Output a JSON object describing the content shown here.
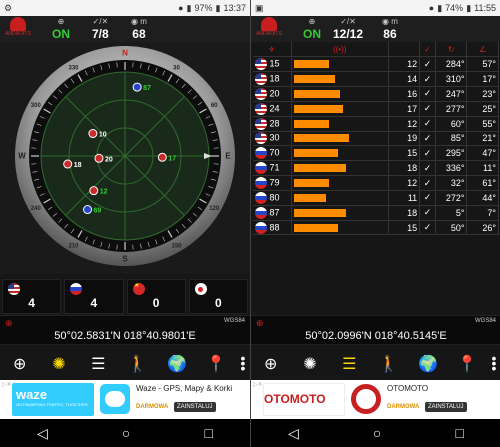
{
  "status_left": {
    "battery": "97%",
    "time": "13:37"
  },
  "status_right": {
    "battery": "74%",
    "time": "11:55"
  },
  "logo_text": "ANDROITS",
  "left_header": {
    "fix": "ON",
    "sats": "7/8",
    "alt": "68",
    "alt_unit": "m"
  },
  "right_header": {
    "fix": "ON",
    "sats": "12/12",
    "alt": "86",
    "alt_unit": "m"
  },
  "compass": {
    "marks": [
      "N",
      "30",
      "60",
      "E",
      "120",
      "150",
      "S",
      "210",
      "240",
      "W",
      "300",
      "330"
    ],
    "sats": [
      {
        "id": "87",
        "flag": "ru",
        "color": "#33cc33"
      },
      {
        "id": "10",
        "flag": "us",
        "color": "#ffffff"
      },
      {
        "id": "20",
        "flag": "us",
        "color": "#ffffff"
      },
      {
        "id": "18",
        "flag": "us",
        "color": "#ffffff"
      },
      {
        "id": "17",
        "flag": "us",
        "color": "#33cc33"
      },
      {
        "id": "12",
        "flag": "us",
        "color": "#33cc33"
      },
      {
        "id": "69",
        "flag": "ru",
        "color": "#33cc33"
      }
    ]
  },
  "counts": [
    {
      "flag": "us",
      "value": "4"
    },
    {
      "flag": "ru",
      "value": "4"
    },
    {
      "flag": "cn",
      "value": "0"
    },
    {
      "flag": "jp",
      "value": "0"
    }
  ],
  "coords_left": {
    "datum": "WGS84",
    "value": "50°02.5831'N  018°40.9801'E"
  },
  "coords_right": {
    "datum": "WGS84",
    "value": "50°02.0996'N  018°40.5145'E"
  },
  "nav_icons": [
    "target-icon",
    "radar-icon",
    "bars-icon",
    "walk-icon",
    "globe-icon",
    "pin-icon",
    "more-icon"
  ],
  "table": {
    "rows": [
      {
        "flag": "us",
        "id": "15",
        "snr": 12,
        "az": "284°",
        "el": "57°"
      },
      {
        "flag": "us",
        "id": "18",
        "snr": 14,
        "az": "310°",
        "el": "17°"
      },
      {
        "flag": "us",
        "id": "20",
        "snr": 16,
        "az": "247°",
        "el": "23°"
      },
      {
        "flag": "us",
        "id": "24",
        "snr": 17,
        "az": "277°",
        "el": "25°"
      },
      {
        "flag": "us",
        "id": "28",
        "snr": 12,
        "az": "60°",
        "el": "55°"
      },
      {
        "flag": "us",
        "id": "30",
        "snr": 19,
        "az": "85°",
        "el": "21°"
      },
      {
        "flag": "ru",
        "id": "70",
        "snr": 15,
        "az": "295°",
        "el": "47°"
      },
      {
        "flag": "ru",
        "id": "71",
        "snr": 18,
        "az": "336°",
        "el": "11°"
      },
      {
        "flag": "ru",
        "id": "79",
        "snr": 12,
        "az": "32°",
        "el": "61°"
      },
      {
        "flag": "ru",
        "id": "80",
        "snr": 11,
        "az": "272°",
        "el": "44°"
      },
      {
        "flag": "ru",
        "id": "87",
        "snr": 18,
        "az": "5°",
        "el": "7°"
      },
      {
        "flag": "ru",
        "id": "88",
        "snr": 15,
        "az": "50°",
        "el": "26°"
      }
    ]
  },
  "ad_left": {
    "brand": "waze",
    "tagline": "OUTSMARTING TRAFFIC, TOGETHER",
    "title": "Waze - GPS, Mapy & Korki",
    "free": "DARMOWA",
    "install": "ZAINSTALUJ"
  },
  "ad_right": {
    "brand": "OTOMOTO",
    "title": "OTOMOTO",
    "free": "DARMOWA",
    "install": "ZAINSTALUJ"
  }
}
